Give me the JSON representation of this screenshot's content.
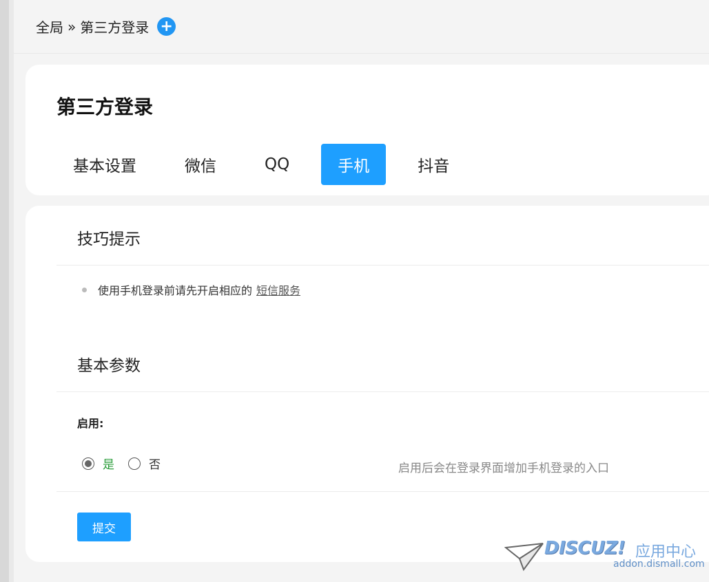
{
  "header": {
    "breadcrumb_root": "全局",
    "breadcrumb_sep": "»",
    "breadcrumb_current": "第三方登录",
    "add_label": "+"
  },
  "page": {
    "title": "第三方登录",
    "tabs": [
      {
        "label": "基本设置",
        "active": false
      },
      {
        "label": "微信",
        "active": false
      },
      {
        "label": "QQ",
        "active": false
      },
      {
        "label": "手机",
        "active": true
      },
      {
        "label": "抖音",
        "active": false
      }
    ]
  },
  "tips": {
    "title": "技巧提示",
    "text": "使用手机登录前请先开启相应的",
    "link": "短信服务"
  },
  "params": {
    "title": "基本参数",
    "enable_label": "启用:",
    "yes_label": "是",
    "no_label": "否",
    "selected": "是",
    "help": "启用后会在登录界面增加手机登录的入口"
  },
  "form": {
    "submit_label": "提交"
  },
  "watermark": {
    "brand": "DISCUZ!",
    "center": "应用中心",
    "url": "addon.dismall.com"
  },
  "colors": {
    "accent": "#1e9fff",
    "yes_green": "#2a9d3a"
  }
}
